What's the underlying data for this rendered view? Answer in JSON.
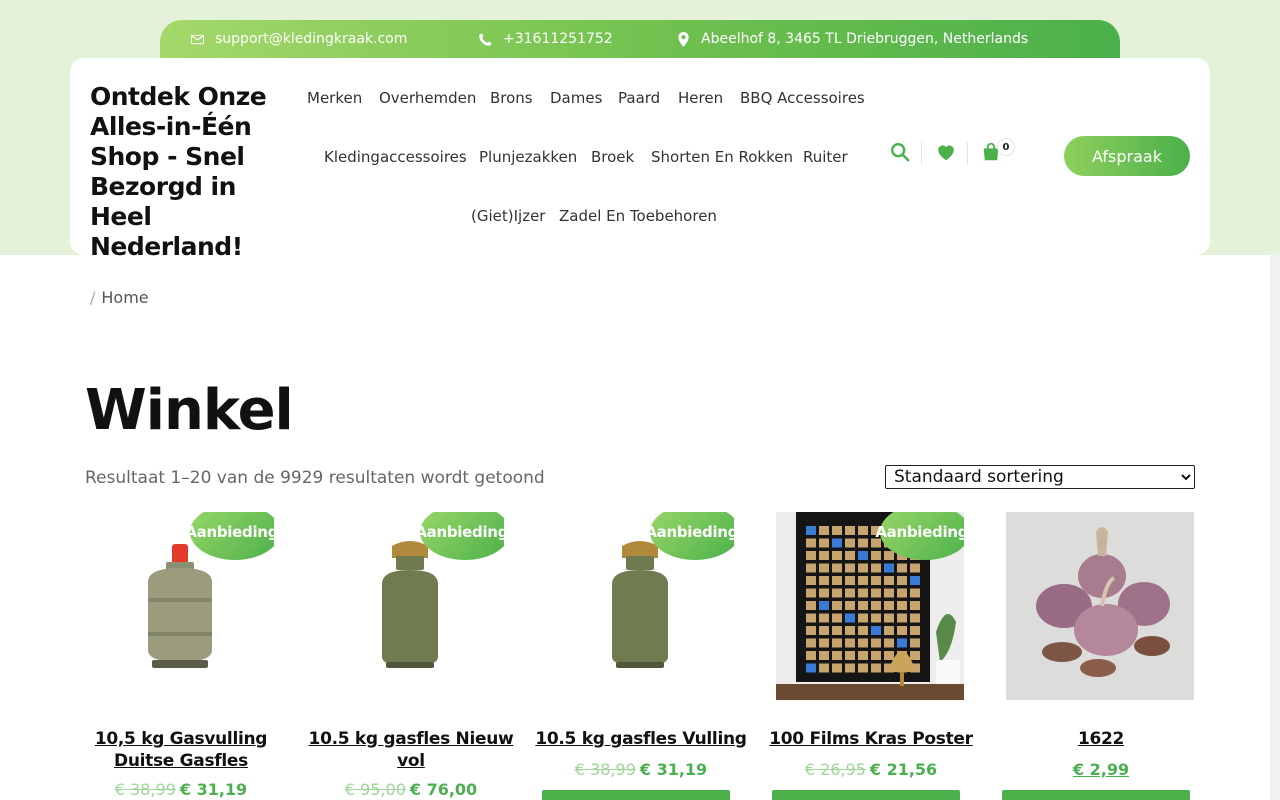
{
  "topbar": {
    "email": "support@kledingkraak.com",
    "phone": "+31611251752",
    "address": "Abeelhof 8, 3465 TL Driebruggen, Netherlands"
  },
  "site": {
    "title": "Ontdek Onze Alles-in-Één Shop - Snel Bezorgd in Heel Nederland!"
  },
  "nav": {
    "row1": [
      "Merken",
      "Overhemden",
      "Brons",
      "Dames",
      "Paard",
      "Heren",
      "BBQ Accessoires"
    ],
    "row2": [
      "Kledingaccessoires",
      "Plunjezakken",
      "Broek",
      "Shorten En Rokken",
      "Ruiter"
    ],
    "row3": [
      "(Giet)Ijzer",
      "Zadel En Toebehoren"
    ]
  },
  "header_icons": {
    "search": "search-icon",
    "wishlist": "heart-icon",
    "cart": "shopping-bag-icon",
    "cart_count": "0"
  },
  "cta_label": "Afspraak",
  "breadcrumb": {
    "home": "Home"
  },
  "page": {
    "title": "Winkel",
    "result_count": "Resultaat 1–20 van de 9929 resultaten wordt getoond",
    "sort_selected": "Standaard sortering"
  },
  "products": [
    {
      "title": "10,5 kg Gasvulling Duitse Gasfles",
      "old_price": "€ 38,99",
      "price": "€ 31,19",
      "badge": "Aanbieding!"
    },
    {
      "title": "10.5 kg gasfles Nieuw vol",
      "old_price": "€ 95,00",
      "price": "€ 76,00",
      "badge": "Aanbieding!"
    },
    {
      "title": "10.5 kg gasfles Vulling",
      "old_price": "€ 38,99",
      "price": "€ 31,19",
      "badge": "Aanbieding!"
    },
    {
      "title": "100 Films Kras Poster",
      "old_price": "€ 26,95",
      "price": "€ 21,56",
      "badge": "Aanbieding!"
    },
    {
      "title": "1622",
      "old_price": "",
      "price": "€ 2,99",
      "badge": ""
    }
  ],
  "colors": {
    "accent": "#4bb04a",
    "accent_light": "#a4d86a",
    "header_bg": "#e3f2d8"
  }
}
